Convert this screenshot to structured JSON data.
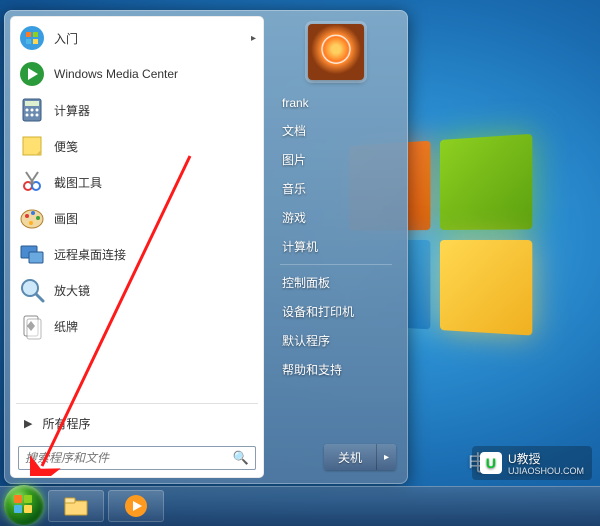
{
  "programs": [
    {
      "label": "入门",
      "icon": "getting-started",
      "hasSubmenu": true
    },
    {
      "label": "Windows Media Center",
      "icon": "media-center",
      "hasSubmenu": false
    },
    {
      "label": "计算器",
      "icon": "calculator",
      "hasSubmenu": false
    },
    {
      "label": "便笺",
      "icon": "sticky-notes",
      "hasSubmenu": false
    },
    {
      "label": "截图工具",
      "icon": "snipping-tool",
      "hasSubmenu": false
    },
    {
      "label": "画图",
      "icon": "paint",
      "hasSubmenu": false
    },
    {
      "label": "远程桌面连接",
      "icon": "remote-desktop",
      "hasSubmenu": false
    },
    {
      "label": "放大镜",
      "icon": "magnifier",
      "hasSubmenu": false
    },
    {
      "label": "纸牌",
      "icon": "solitaire",
      "hasSubmenu": false
    }
  ],
  "allPrograms": {
    "label": "所有程序"
  },
  "search": {
    "placeholder": "搜索程序和文件"
  },
  "user": {
    "name": "frank"
  },
  "rightItems": {
    "group1": [
      "文档",
      "图片",
      "音乐",
      "游戏",
      "计算机"
    ],
    "group2": [
      "控制面板",
      "设备和打印机",
      "默认程序",
      "帮助和支持"
    ]
  },
  "shutdown": {
    "label": "关机"
  },
  "watermark": {
    "brand": "U教授",
    "url": "UJIAOSHOU.COM"
  },
  "bottomText": "电"
}
